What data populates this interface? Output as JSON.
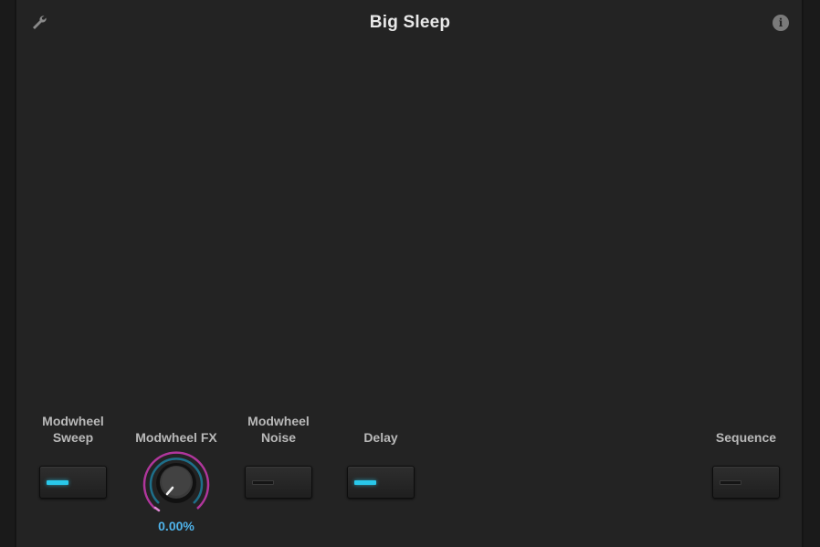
{
  "header": {
    "title": "Big Sleep",
    "settings_icon": "wrench-icon",
    "info_icon": "info-icon",
    "info_glyph": "i"
  },
  "controls": {
    "modwheel_sweep": {
      "label": "Modwheel\nSweep",
      "state": "on"
    },
    "modwheel_fx": {
      "label": "Modwheel FX",
      "value": "0.00%"
    },
    "modwheel_noise": {
      "label": "Modwheel\nNoise",
      "state": "off"
    },
    "delay": {
      "label": "Delay",
      "state": "on"
    },
    "sequence": {
      "label": "Sequence",
      "state": "off"
    }
  },
  "colors": {
    "background": "#232323",
    "led_on": "#29c8ea",
    "knob_value_text": "#4fb3ea",
    "knob_ring_outer": "#b0369c",
    "knob_ring_inner": "#1e6f8a"
  }
}
